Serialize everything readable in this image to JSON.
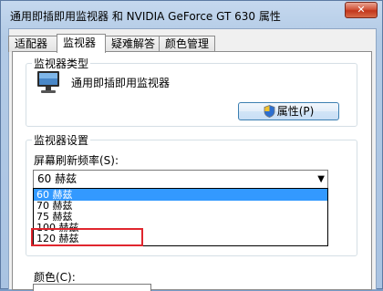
{
  "window": {
    "title": "通用即插即用监视器 和 NVIDIA GeForce GT 630 属性",
    "close_label": "✕"
  },
  "tabs": [
    {
      "label": "适配器",
      "active": false
    },
    {
      "label": "监视器",
      "active": true
    },
    {
      "label": "疑难解答",
      "active": false
    },
    {
      "label": "颜色管理",
      "active": false
    }
  ],
  "monitor_type": {
    "group_title": "监视器类型",
    "monitor_name": "通用即插即用监视器",
    "properties_button": "属性(P)"
  },
  "monitor_settings": {
    "group_title": "监视器设置",
    "refresh_label": "屏幕刷新频率(S):",
    "selected_value": "60 赫兹",
    "options": [
      "60 赫兹",
      "70 赫兹",
      "75 赫兹",
      "100 赫兹",
      "120 赫兹"
    ],
    "highlighted_option": "120 赫兹"
  },
  "colors": {
    "label": "颜色(C):"
  }
}
